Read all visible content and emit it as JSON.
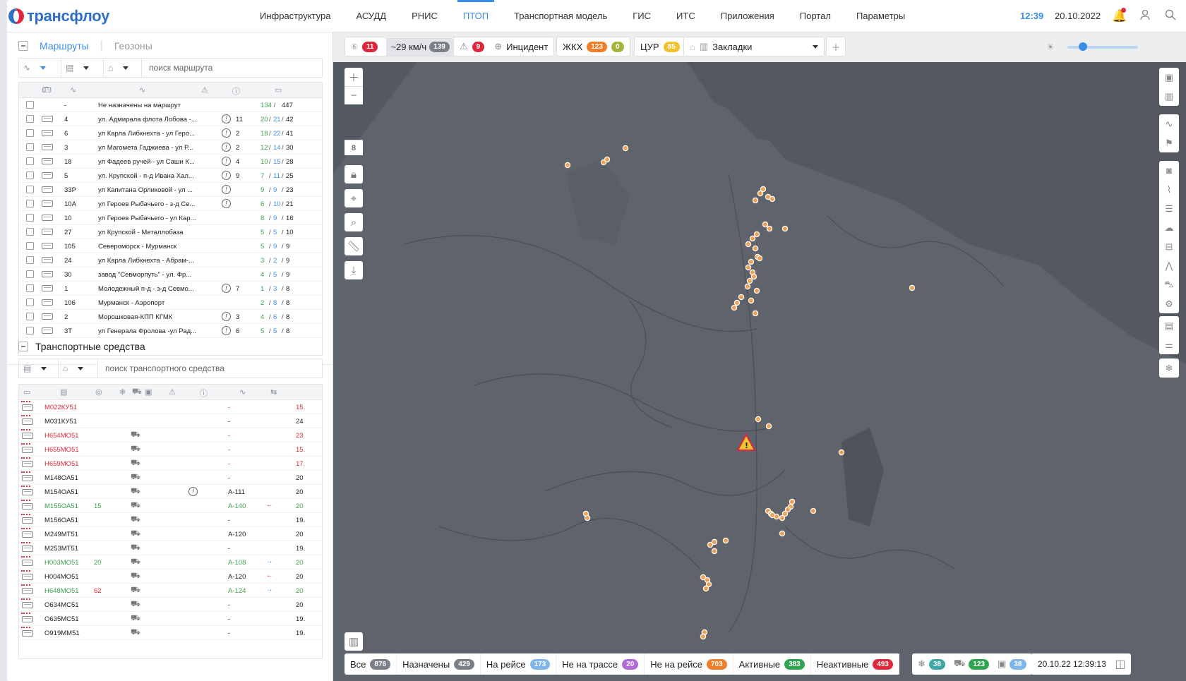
{
  "app": {
    "brand_a": "транс",
    "brand_b": "флоу"
  },
  "nav": [
    "Инфраструктура",
    "АСУДД",
    "РНИС",
    "ПТОП",
    "Транспортная модель",
    "ГИС",
    "ИТС",
    "Приложения",
    "Портал",
    "Параметры"
  ],
  "nav_active": "ПТОП",
  "header": {
    "time": "12:39",
    "date": "20.10.2022"
  },
  "routes": {
    "tab_routes": "Маршруты",
    "tab_geozones": "Геозоны",
    "search_placeholder": "поиск маршрута",
    "rows": [
      {
        "num": "-",
        "name": "Не назначены на маршрут",
        "warn": "",
        "a": "134",
        "b": "",
        "c": "447"
      },
      {
        "num": "4",
        "name": "ул. Адмирала флота Лобова -...",
        "warn": "11",
        "a": "20",
        "b": "21",
        "c": "42"
      },
      {
        "num": "6",
        "name": "ул Карла Либкнехта - ул Геро...",
        "warn": "2",
        "a": "18",
        "b": "22",
        "c": "41"
      },
      {
        "num": "3",
        "name": "ул Магомета Гаджиева - ул Р...",
        "warn": "2",
        "a": "12",
        "b": "14",
        "c": "30"
      },
      {
        "num": "18",
        "name": "ул Фадеев ручей - ул Саши К...",
        "warn": "4",
        "a": "10",
        "b": "15",
        "c": "28"
      },
      {
        "num": "5",
        "name": "ул. Крупской - п-д Ивана Хал...",
        "warn": "9",
        "a": "7",
        "b": "11",
        "c": "25"
      },
      {
        "num": "33Р",
        "name": "ул Капитана Орликовой - ул ...",
        "warn": "",
        "a": "9",
        "b": "9",
        "c": "23"
      },
      {
        "num": "10А",
        "name": "ул Героев Рыбачьего - з-д Се...",
        "warn": "",
        "a": "6",
        "b": "10",
        "c": "21"
      },
      {
        "num": "10",
        "name": "ул Героев Рыбачьего - ул Кар...",
        "warn": "",
        "a": "8",
        "b": "9",
        "c": "16"
      },
      {
        "num": "27",
        "name": "ул Крупской - Металлобаза",
        "warn": "",
        "a": "5",
        "b": "5",
        "c": "10"
      },
      {
        "num": "105",
        "name": "Североморск - Мурманск",
        "warn": "",
        "a": "5",
        "b": "9",
        "c": "9"
      },
      {
        "num": "24",
        "name": "ул Карла Либкнехта - Абрам-...",
        "warn": "",
        "a": "3",
        "b": "2",
        "c": "9"
      },
      {
        "num": "30",
        "name": "завод \"Севморпуть\" - ул. Фр...",
        "warn": "",
        "a": "4",
        "b": "5",
        "c": "9"
      },
      {
        "num": "1",
        "name": "Молодежный п-д - з-д Севмо...",
        "warn": "7",
        "a": "1",
        "b": "3",
        "c": "8"
      },
      {
        "num": "106",
        "name": "Мурманск - Аэропорт",
        "warn": "",
        "a": "2",
        "b": "8",
        "c": "8"
      },
      {
        "num": "2",
        "name": "Морошковая-КПП КГМК",
        "warn": "3",
        "a": "4",
        "b": "6",
        "c": "8"
      },
      {
        "num": "3Т",
        "name": "ул Генерала Фролова -ул Рад...",
        "warn": "6",
        "a": "5",
        "b": "5",
        "c": "8"
      }
    ]
  },
  "vehicles": {
    "title": "Транспортные средства",
    "search_placeholder": "поиск транспортного средства",
    "rows": [
      {
        "plate": "М022КУ51",
        "color": "red",
        "speed": "",
        "icon": false,
        "warn": false,
        "route": "-",
        "arrow": "",
        "last": "15."
      },
      {
        "plate": "М031КУ51",
        "color": "black",
        "speed": "",
        "icon": false,
        "warn": false,
        "route": "-",
        "arrow": "",
        "last": "24"
      },
      {
        "plate": "Н654МО51",
        "color": "red",
        "speed": "",
        "icon": true,
        "warn": false,
        "route": "-",
        "arrow": "",
        "last": "23"
      },
      {
        "plate": "Н655МО51",
        "color": "red",
        "speed": "",
        "icon": true,
        "warn": false,
        "route": "-",
        "arrow": "",
        "last": "15."
      },
      {
        "plate": "Н659МО51",
        "color": "red",
        "speed": "",
        "icon": true,
        "warn": false,
        "route": "-",
        "arrow": "",
        "last": "17."
      },
      {
        "plate": "М148ОА51",
        "color": "black",
        "speed": "",
        "icon": true,
        "warn": false,
        "route": "-",
        "arrow": "",
        "last": "20"
      },
      {
        "plate": "М154ОА51",
        "color": "black",
        "speed": "",
        "icon": true,
        "warn": true,
        "route": "А-111",
        "arrow": "",
        "last": "20"
      },
      {
        "plate": "М155ОА51",
        "color": "green",
        "speed": "15",
        "icon": true,
        "warn": false,
        "route": "А-140",
        "arrow": "←",
        "last": "20"
      },
      {
        "plate": "М156ОА51",
        "color": "black",
        "speed": "",
        "icon": true,
        "warn": false,
        "route": "-",
        "arrow": "",
        "last": "19."
      },
      {
        "plate": "М249МТ51",
        "color": "black",
        "speed": "",
        "icon": true,
        "warn": false,
        "route": "А-120",
        "arrow": "",
        "last": "20"
      },
      {
        "plate": "М253МТ51",
        "color": "black",
        "speed": "",
        "icon": true,
        "warn": false,
        "route": "-",
        "arrow": "",
        "last": "19."
      },
      {
        "plate": "Н003МО51",
        "color": "green",
        "speed": "20",
        "icon": true,
        "warn": false,
        "route": "А-108",
        "arrow": "→",
        "last": "20"
      },
      {
        "plate": "Н004МО51",
        "color": "black",
        "speed": "",
        "icon": true,
        "warn": false,
        "route": "А-120",
        "arrow": "←",
        "last": "20"
      },
      {
        "plate": "Н648МО51",
        "color": "green",
        "speed": "62",
        "icon": true,
        "warn": false,
        "route": "А-124",
        "arrow": "→",
        "last": "20"
      },
      {
        "plate": "О634МС51",
        "color": "black",
        "speed": "",
        "icon": true,
        "warn": false,
        "route": "-",
        "arrow": "",
        "last": "20"
      },
      {
        "plate": "О635МС51",
        "color": "black",
        "speed": "",
        "icon": true,
        "warn": false,
        "route": "-",
        "arrow": "",
        "last": "19."
      },
      {
        "plate": "О919ММ51",
        "color": "black",
        "speed": "",
        "icon": true,
        "warn": false,
        "route": "-",
        "arrow": "",
        "last": "19."
      }
    ]
  },
  "map_top": {
    "speed_count": "11",
    "avg_speed": "~29 км/ч",
    "avg_speed_count": "139",
    "incident_count": "9",
    "incident_label": "Инцидент",
    "zhkh_label": "ЖКХ",
    "zhkh_a": "123",
    "zhkh_b": "0",
    "cur_label": "ЦУР",
    "cur_count": "85",
    "bookmarks": "Закладки"
  },
  "zoom_level": "8",
  "map_bottom": [
    {
      "label": "Все",
      "count": "876",
      "color": "gray"
    },
    {
      "label": "Назначены",
      "count": "429",
      "color": "gray"
    },
    {
      "label": "На рейсе",
      "count": "173",
      "color": "blue"
    },
    {
      "label": "Не на трассе",
      "count": "20",
      "color": "purple"
    },
    {
      "label": "Не на рейсе",
      "count": "703",
      "color": "orange"
    },
    {
      "label": "Активные",
      "count": "383",
      "color": "green"
    },
    {
      "label": "Неактивные",
      "count": "493",
      "color": "red"
    }
  ],
  "map_bottom_right": {
    "snow_count": "38",
    "tractor_count": "123",
    "camera_count": "38",
    "timestamp": "20.10.22 12:39:13"
  },
  "colors": {
    "accent": "#3b8ee8",
    "map_bg": "#545861",
    "land": "#6b6f78",
    "marker": "#f0a052",
    "danger": "#e0263a",
    "ok": "#3aa44f"
  }
}
